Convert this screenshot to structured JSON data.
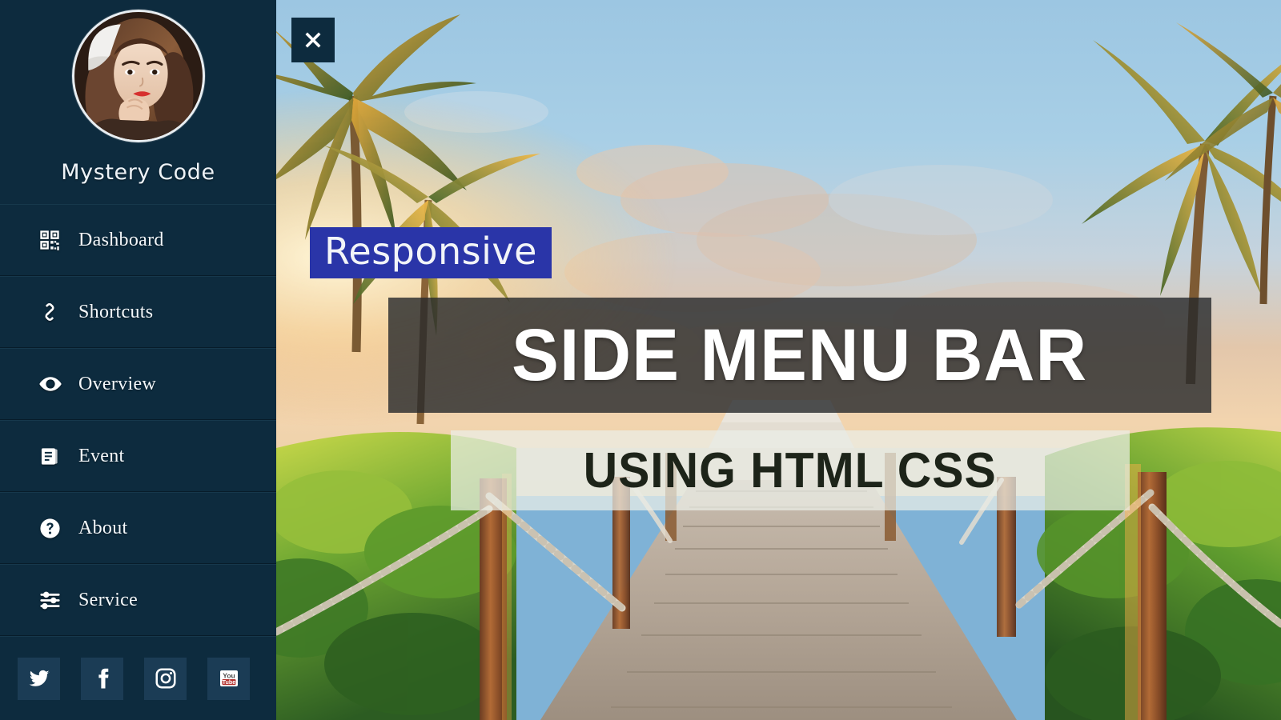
{
  "sidebar": {
    "profile": {
      "name": "Mystery Code",
      "avatar_alt": "profile-photo"
    },
    "menu_items": [
      {
        "label": "Dashboard",
        "icon": "qrcode-icon"
      },
      {
        "label": "Shortcuts",
        "icon": "link-chain-icon"
      },
      {
        "label": "Overview",
        "icon": "eye-icon"
      },
      {
        "label": "Event",
        "icon": "book-icon"
      },
      {
        "label": "About",
        "icon": "question-circle-icon"
      },
      {
        "label": "Service",
        "icon": "sliders-icon"
      }
    ],
    "social_links": [
      {
        "name": "twitter",
        "icon": "twitter-icon"
      },
      {
        "name": "facebook",
        "icon": "facebook-icon"
      },
      {
        "name": "instagram",
        "icon": "instagram-icon"
      },
      {
        "name": "youtube",
        "icon": "youtube-icon"
      }
    ],
    "background_color": "#0d2b3e"
  },
  "main": {
    "close_button": {
      "icon": "close-x-icon",
      "label": "✖"
    },
    "badge": {
      "text": "Responsive",
      "background_color": "#2a35a8",
      "text_color": "#f2f4f8"
    },
    "title": {
      "text": "SIDE MENU BAR",
      "background_color": "rgba(38,40,42,0.80)",
      "text_color": "#ffffff"
    },
    "subtitle": {
      "text": "USING HTML CSS",
      "background_color": "rgba(236,238,232,0.72)",
      "text_color": "#1d2419"
    },
    "background_image": "beach-boardwalk-sunset-palm-trees"
  }
}
